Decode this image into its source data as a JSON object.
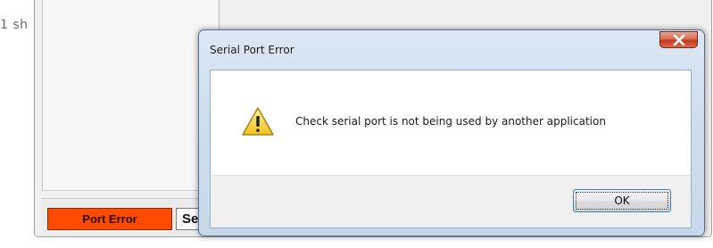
{
  "background_app": {
    "left_text": "1 sh",
    "status_badge": "Port Error",
    "status_field_text": "Se"
  },
  "dialog": {
    "title": "Serial Port Error",
    "message": "Check serial port is not being used by another application",
    "ok_label": "OK",
    "icon": "warning-icon",
    "close_icon": "close-icon"
  },
  "colors": {
    "badge_bg": "#ff4a00",
    "close_button": "#c43a1e",
    "ok_border": "#3c7fb1"
  }
}
